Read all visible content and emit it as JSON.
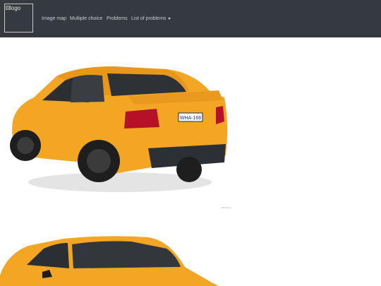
{
  "navbar": {
    "logo_alt": "logo",
    "links": [
      {
        "label": "Image map"
      },
      {
        "label": "Multiple choice"
      },
      {
        "label": "Problems"
      },
      {
        "label": "List of problems"
      }
    ]
  },
  "images": {
    "car1": {
      "subject": "orange sedan rear view",
      "plate": "WHA-166",
      "caption": "AlphaMom"
    },
    "car2": {
      "subject": "orange sedan front view"
    }
  },
  "colors": {
    "navbar_bg": "#343a40",
    "nav_link": "#c9cdd2",
    "car_body": "#f2a623"
  }
}
